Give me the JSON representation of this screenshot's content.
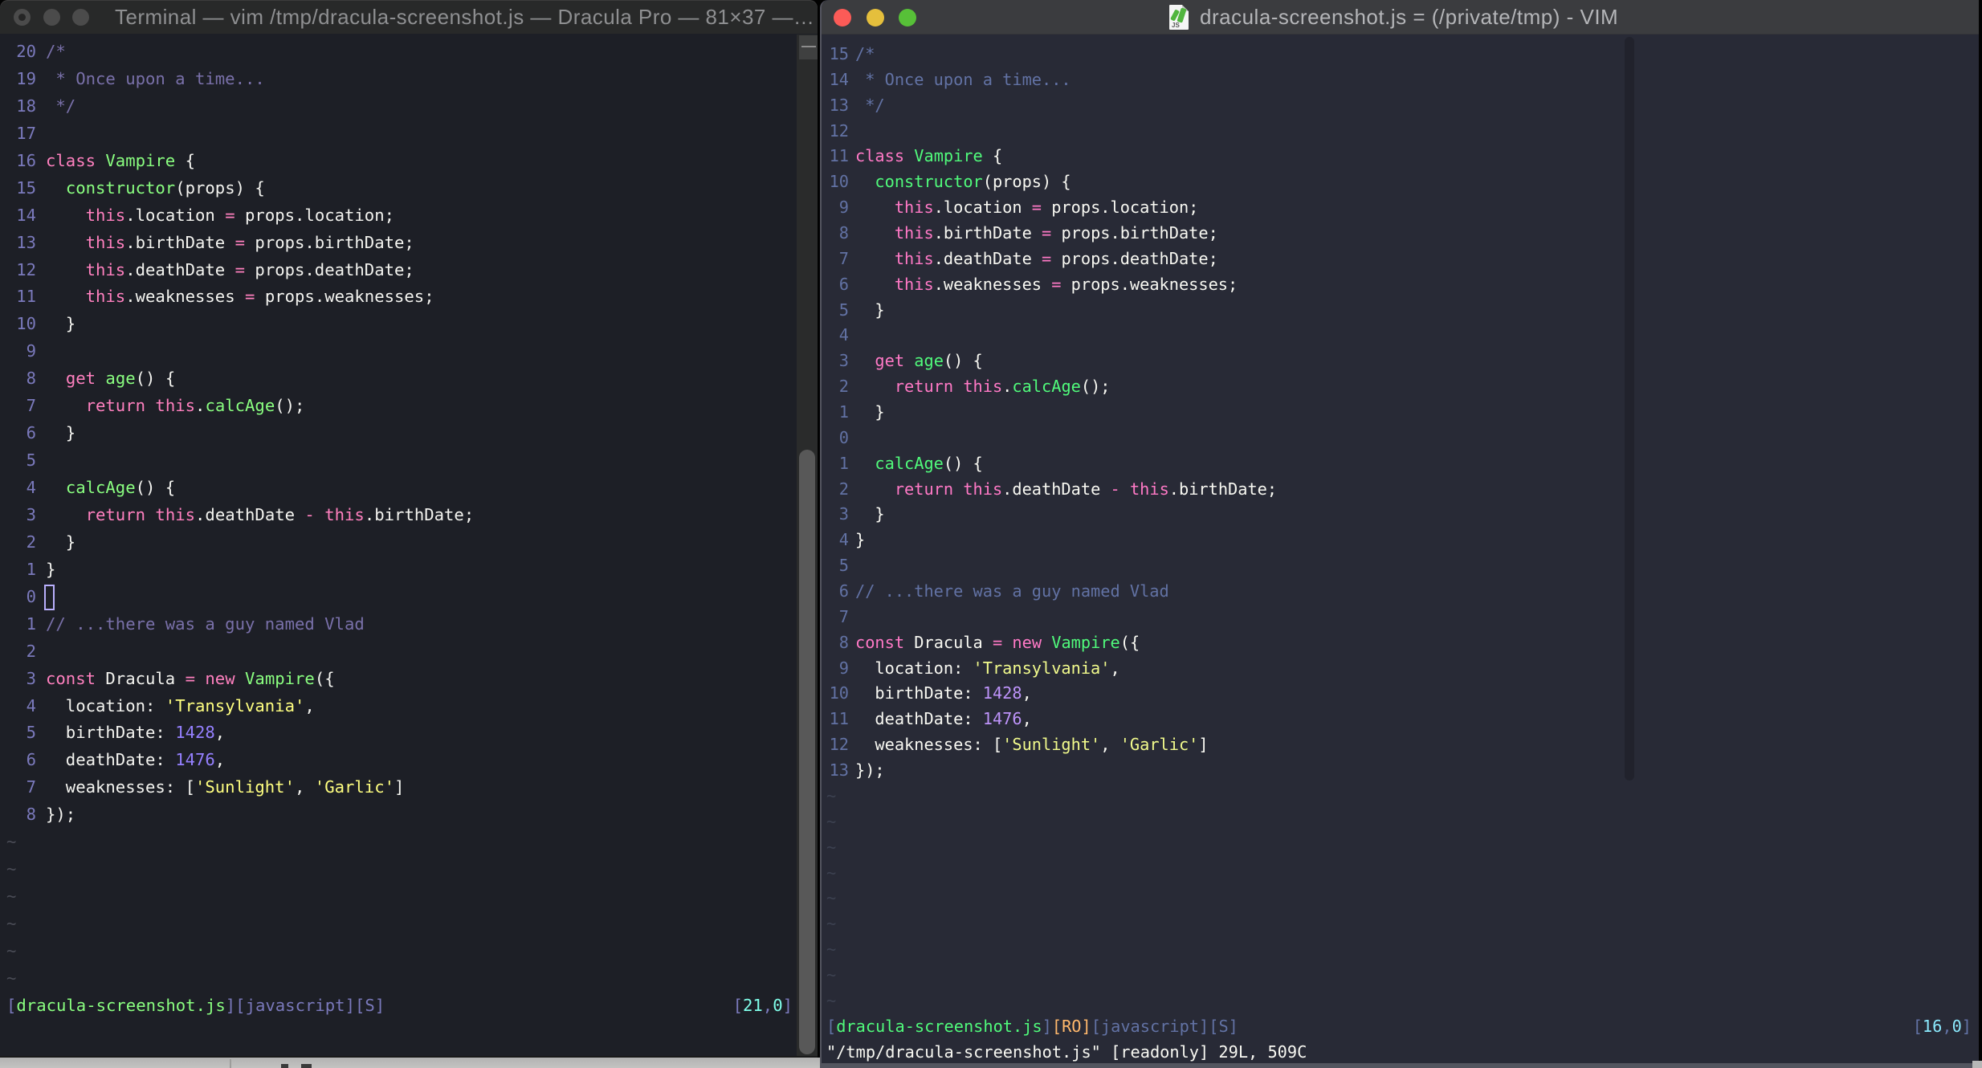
{
  "left_window": {
    "title": "Terminal — vim /tmp/dracula-screenshot.js — Dracula Pro — 81×37 —…",
    "theme_name": "Dracula Pro",
    "tilde": "~",
    "tilde_count": 6,
    "status_left_segments": [
      [
        "linenr",
        "["
      ],
      [
        "green",
        "dracula-screenshot.js"
      ],
      [
        "linenr",
        "][javascript][S]"
      ]
    ],
    "status_right_segments": [
      [
        "linenr",
        "["
      ],
      [
        "cyan",
        "21"
      ],
      [
        "linenr",
        ","
      ],
      [
        "cyan",
        "0"
      ],
      [
        "linenr",
        "]"
      ]
    ],
    "command_line": "",
    "palette": {
      "bg": "#1d1f26",
      "fg": "#f4f4f0",
      "linenr": "#7a79bb",
      "comment": "#7970a9",
      "pink": "#ff80bf",
      "green": "#8aff80",
      "purple": "#9580ff",
      "yellow": "#ffff80",
      "cyan": "#80ffea",
      "orange": "#ffca80",
      "tilde": "#4a4c56",
      "cursor": "#b9affd",
      "titlebar": "#282929",
      "title_text": "#8e8f91",
      "traffic_light": "#4b4b4b"
    }
  },
  "right_window": {
    "title": "dracula-screenshot.js = (/private/tmp) - VIM",
    "tilde": "~",
    "tilde_count": 9,
    "status_left_segments": [
      [
        "linenr",
        "["
      ],
      [
        "green",
        "dracula-screenshot.js"
      ],
      [
        "linenr",
        "]"
      ],
      [
        "orange",
        "[RO]"
      ],
      [
        "linenr",
        "[javascript][S]"
      ]
    ],
    "status_right_segments": [
      [
        "linenr",
        "["
      ],
      [
        "cyan",
        "16"
      ],
      [
        "linenr",
        ","
      ],
      [
        "cyan",
        "0"
      ],
      [
        "linenr",
        "]"
      ]
    ],
    "command_line": "\"/tmp/dracula-screenshot.js\" [readonly] 29L, 509C",
    "palette": {
      "bg": "#282a36",
      "fg": "#f8f8f2",
      "linenr": "#6272a4",
      "comment": "#6272a4",
      "pink": "#ff79c6",
      "green": "#50fa7b",
      "purple": "#bd93f9",
      "yellow": "#f1fa8c",
      "cyan": "#8be9fd",
      "orange": "#ffb86c",
      "tilde": "#3c4150",
      "titlebar": "#3b3c3f",
      "title_text": "#b4b5b8",
      "traffic_lights": {
        "close": "#fc5b57",
        "minimize": "#e5bf3c",
        "zoom": "#57c038"
      }
    }
  },
  "code_lines": [
    {
      "ln_left": "20",
      "ln_right": "15",
      "segments": [
        [
          "comment",
          "/*"
        ]
      ]
    },
    {
      "ln_left": "19",
      "ln_right": "14",
      "segments": [
        [
          "comment",
          " * Once upon a time..."
        ]
      ]
    },
    {
      "ln_left": "18",
      "ln_right": "13",
      "segments": [
        [
          "comment",
          " */"
        ]
      ]
    },
    {
      "ln_left": "17",
      "ln_right": "12",
      "segments": []
    },
    {
      "ln_left": "16",
      "ln_right": "11",
      "segments": [
        [
          "pink",
          "class"
        ],
        [
          "fg",
          " "
        ],
        [
          "green",
          "Vampire"
        ],
        [
          "fg",
          " {"
        ]
      ]
    },
    {
      "ln_left": "15",
      "ln_right": "10",
      "segments": [
        [
          "fg",
          "  "
        ],
        [
          "green",
          "constructor"
        ],
        [
          "fg",
          "(props) {"
        ]
      ]
    },
    {
      "ln_left": "14",
      "ln_right": "9",
      "segments": [
        [
          "fg",
          "    "
        ],
        [
          "pink",
          "this"
        ],
        [
          "fg",
          ".location "
        ],
        [
          "pink",
          "="
        ],
        [
          "fg",
          " props.location;"
        ]
      ]
    },
    {
      "ln_left": "13",
      "ln_right": "8",
      "segments": [
        [
          "fg",
          "    "
        ],
        [
          "pink",
          "this"
        ],
        [
          "fg",
          ".birthDate "
        ],
        [
          "pink",
          "="
        ],
        [
          "fg",
          " props.birthDate;"
        ]
      ]
    },
    {
      "ln_left": "12",
      "ln_right": "7",
      "segments": [
        [
          "fg",
          "    "
        ],
        [
          "pink",
          "this"
        ],
        [
          "fg",
          ".deathDate "
        ],
        [
          "pink",
          "="
        ],
        [
          "fg",
          " props.deathDate;"
        ]
      ]
    },
    {
      "ln_left": "11",
      "ln_right": "6",
      "segments": [
        [
          "fg",
          "    "
        ],
        [
          "pink",
          "this"
        ],
        [
          "fg",
          ".weaknesses "
        ],
        [
          "pink",
          "="
        ],
        [
          "fg",
          " props.weaknesses;"
        ]
      ]
    },
    {
      "ln_left": "10",
      "ln_right": "5",
      "segments": [
        [
          "fg",
          "  }"
        ]
      ]
    },
    {
      "ln_left": "9",
      "ln_right": "4",
      "segments": []
    },
    {
      "ln_left": "8",
      "ln_right": "3",
      "segments": [
        [
          "fg",
          "  "
        ],
        [
          "pink",
          "get"
        ],
        [
          "fg",
          " "
        ],
        [
          "green",
          "age"
        ],
        [
          "fg",
          "() {"
        ]
      ]
    },
    {
      "ln_left": "7",
      "ln_right": "2",
      "segments": [
        [
          "fg",
          "    "
        ],
        [
          "pink",
          "return"
        ],
        [
          "fg",
          " "
        ],
        [
          "pink",
          "this"
        ],
        [
          "fg",
          "."
        ],
        [
          "green",
          "calcAge"
        ],
        [
          "fg",
          "();"
        ]
      ]
    },
    {
      "ln_left": "6",
      "ln_right": "1",
      "segments": [
        [
          "fg",
          "  }"
        ]
      ]
    },
    {
      "ln_left": "5",
      "ln_right": "0",
      "segments": []
    },
    {
      "ln_left": "4",
      "ln_right": "1",
      "segments": [
        [
          "fg",
          "  "
        ],
        [
          "green",
          "calcAge"
        ],
        [
          "fg",
          "() {"
        ]
      ]
    },
    {
      "ln_left": "3",
      "ln_right": "2",
      "segments": [
        [
          "fg",
          "    "
        ],
        [
          "pink",
          "return"
        ],
        [
          "fg",
          " "
        ],
        [
          "pink",
          "this"
        ],
        [
          "fg",
          ".deathDate "
        ],
        [
          "pink",
          "-"
        ],
        [
          "fg",
          " "
        ],
        [
          "pink",
          "this"
        ],
        [
          "fg",
          ".birthDate;"
        ]
      ]
    },
    {
      "ln_left": "2",
      "ln_right": "3",
      "segments": [
        [
          "fg",
          "  }"
        ]
      ]
    },
    {
      "ln_left": "1",
      "ln_right": "4",
      "segments": [
        [
          "fg",
          "}"
        ]
      ]
    },
    {
      "ln_left": "0",
      "ln_right": "5",
      "segments": [],
      "left_cursor": true
    },
    {
      "ln_left": "1",
      "ln_right": "6",
      "segments": [
        [
          "comment",
          "// ...there was a guy named Vlad"
        ]
      ]
    },
    {
      "ln_left": "2",
      "ln_right": "7",
      "segments": []
    },
    {
      "ln_left": "3",
      "ln_right": "8",
      "segments": [
        [
          "pink",
          "const"
        ],
        [
          "fg",
          " Dracula "
        ],
        [
          "pink",
          "="
        ],
        [
          "fg",
          " "
        ],
        [
          "pink",
          "new"
        ],
        [
          "fg",
          " "
        ],
        [
          "green",
          "Vampire"
        ],
        [
          "fg",
          "({"
        ]
      ]
    },
    {
      "ln_left": "4",
      "ln_right": "9",
      "segments": [
        [
          "fg",
          "  location: "
        ],
        [
          "yellow",
          "'Transylvania'"
        ],
        [
          "fg",
          ","
        ]
      ]
    },
    {
      "ln_left": "5",
      "ln_right": "10",
      "segments": [
        [
          "fg",
          "  birthDate: "
        ],
        [
          "purple",
          "1428"
        ],
        [
          "fg",
          ","
        ]
      ]
    },
    {
      "ln_left": "6",
      "ln_right": "11",
      "segments": [
        [
          "fg",
          "  deathDate: "
        ],
        [
          "purple",
          "1476"
        ],
        [
          "fg",
          ","
        ]
      ]
    },
    {
      "ln_left": "7",
      "ln_right": "12",
      "segments": [
        [
          "fg",
          "  weaknesses: ["
        ],
        [
          "yellow",
          "'Sunlight'"
        ],
        [
          "fg",
          ", "
        ],
        [
          "yellow",
          "'Garlic'"
        ],
        [
          "fg",
          "]"
        ]
      ]
    },
    {
      "ln_left": "8",
      "ln_right": "13",
      "segments": [
        [
          "fg",
          "});"
        ]
      ]
    }
  ]
}
